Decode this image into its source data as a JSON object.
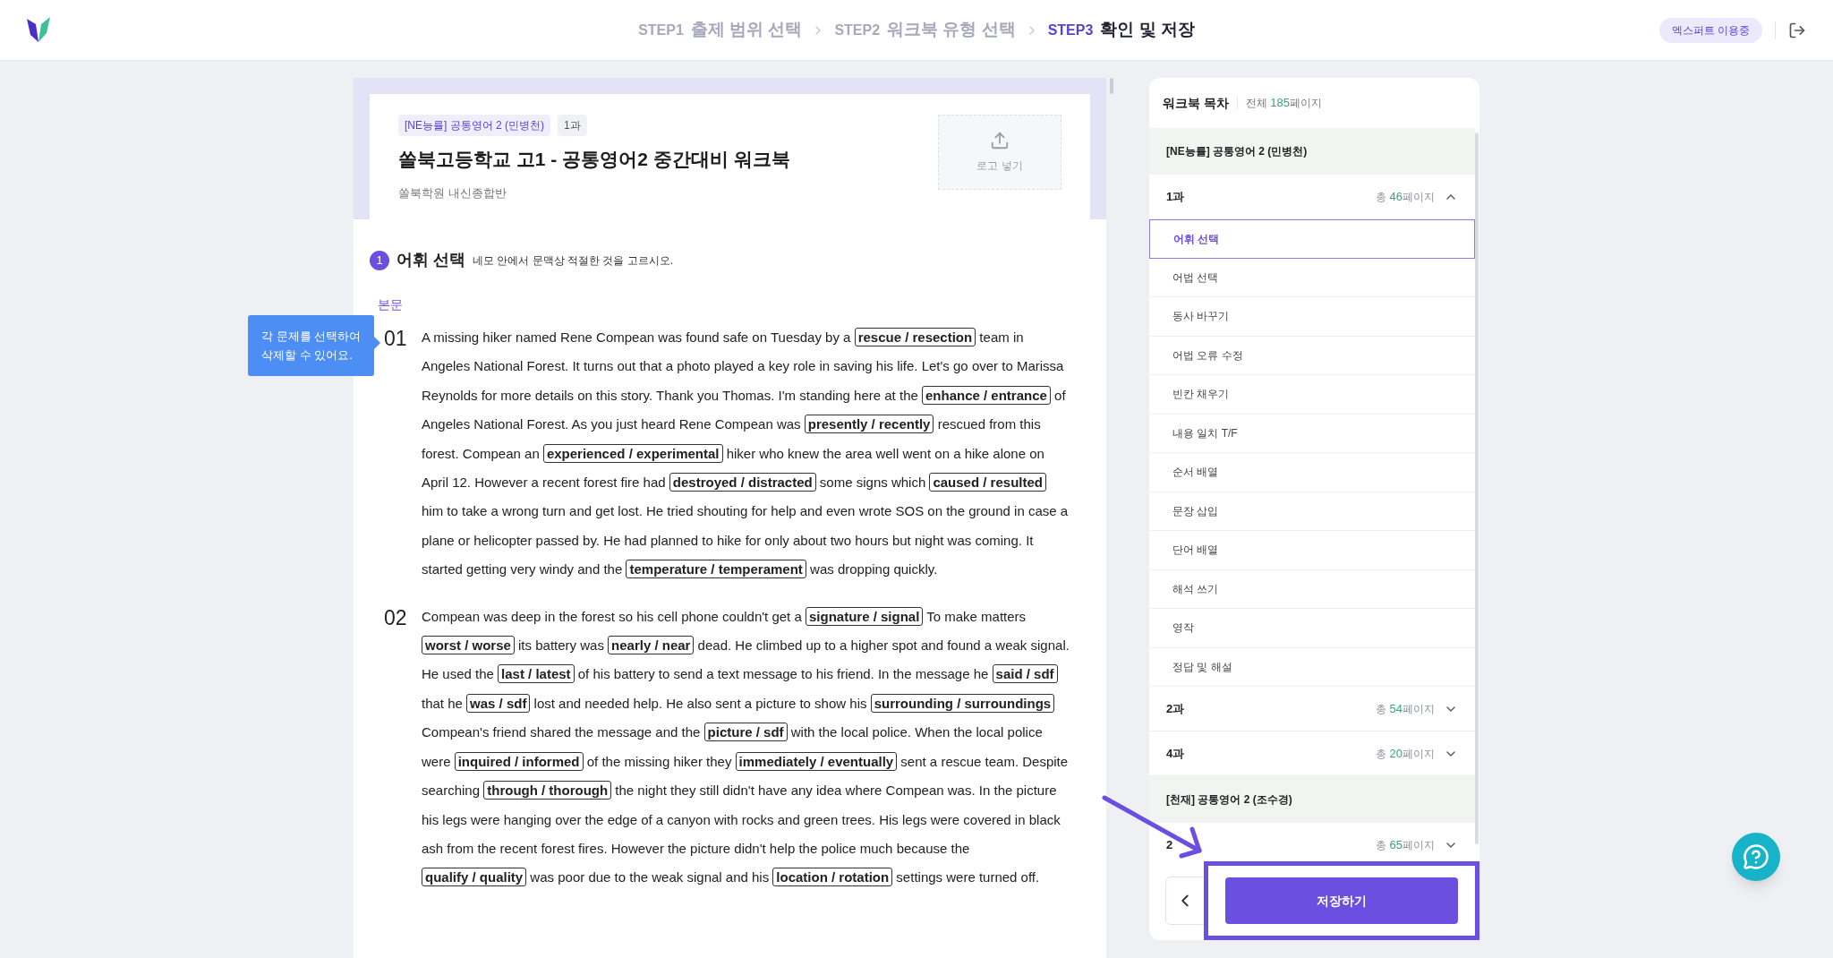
{
  "header": {
    "steps": [
      {
        "label": "STEP1",
        "title": "출제 범위 선택",
        "selected": false
      },
      {
        "label": "STEP2",
        "title": "워크북 유형 선택",
        "selected": false
      },
      {
        "label": "STEP3",
        "title": "확인 및 저장",
        "selected": true
      }
    ],
    "plan_badge": "엑스퍼트 이용중"
  },
  "document": {
    "tags": [
      "[NE능률] 공통영어 2 (민병천)",
      "1과"
    ],
    "title": "쏠북고등학교 고1 - 공통영어2 중간대비 워크북",
    "subtitle": "쏠북학원 내신종합반",
    "logo_upload": "로고 넣기",
    "tooltip": [
      "각 문제를 선택하여",
      "삭제할 수 있어요."
    ],
    "section": {
      "number": "1",
      "title": "어휘 선택",
      "instruction": "네모 안에서 문맥상 적절한 것을 고르시오.",
      "label": "본문",
      "questions": [
        {
          "number": "01",
          "segments": [
            {
              "kind": "text",
              "text": "A missing hiker named Rene Compean was found safe on Tuesday by a "
            },
            {
              "kind": "choice",
              "text": "rescue / resection"
            },
            {
              "kind": "text",
              "text": " team in Angeles National Forest. It turns out that a photo played a key role in saving his life. Let's go over to Marissa Reynolds for more details on this story. Thank you Thomas. I'm standing here at the "
            },
            {
              "kind": "choice",
              "text": "enhance / entrance"
            },
            {
              "kind": "text",
              "text": " of Angeles National Forest. As you just heard Rene Compean was "
            },
            {
              "kind": "choice",
              "text": "presently / recently"
            },
            {
              "kind": "text",
              "text": " rescued from this forest. Compean an "
            },
            {
              "kind": "choice",
              "text": "experienced / experimental"
            },
            {
              "kind": "text",
              "text": " hiker who knew the area well went on a hike alone on April 12. However a recent forest fire had "
            },
            {
              "kind": "choice",
              "text": "destroyed / distracted"
            },
            {
              "kind": "text",
              "text": " some signs which "
            },
            {
              "kind": "choice",
              "text": "caused / resulted"
            },
            {
              "kind": "text",
              "text": " him to take a wrong turn and get lost. He tried shouting for help and even wrote SOS on the ground in case a plane or helicopter passed by. He had planned to hike for only about two hours but night was coming. It started getting very windy and the "
            },
            {
              "kind": "choice",
              "text": "temperature / temperament"
            },
            {
              "kind": "text",
              "text": " was dropping quickly."
            }
          ]
        },
        {
          "number": "02",
          "segments": [
            {
              "kind": "text",
              "text": "Compean was deep in the forest so his cell phone couldn't get a "
            },
            {
              "kind": "choice",
              "text": "signature / signal"
            },
            {
              "kind": "text",
              "text": " To make matters "
            },
            {
              "kind": "choice",
              "text": "worst / worse"
            },
            {
              "kind": "text",
              "text": " its battery was "
            },
            {
              "kind": "choice",
              "text": "nearly / near"
            },
            {
              "kind": "text",
              "text": " dead. He climbed up to a higher spot and found a weak signal. He used the "
            },
            {
              "kind": "choice",
              "text": "last / latest"
            },
            {
              "kind": "text",
              "text": " of his battery to send a text message to his friend. In the message he "
            },
            {
              "kind": "choice",
              "text": "said / sdf"
            },
            {
              "kind": "text",
              "text": " that he "
            },
            {
              "kind": "choice",
              "text": "was / sdf"
            },
            {
              "kind": "text",
              "text": " lost and needed help. He also sent a picture to show his "
            },
            {
              "kind": "choice",
              "text": "surrounding / surroundings"
            },
            {
              "kind": "text",
              "text": "  Compean's friend shared the message and the "
            },
            {
              "kind": "choice",
              "text": "picture / sdf"
            },
            {
              "kind": "text",
              "text": " with the local police. When the local police were "
            },
            {
              "kind": "choice",
              "text": "inquired / informed"
            },
            {
              "kind": "text",
              "text": " of the missing hiker they "
            },
            {
              "kind": "choice",
              "text": "immediately / eventually"
            },
            {
              "kind": "text",
              "text": " sent a rescue team. Despite searching "
            },
            {
              "kind": "choice",
              "text": "through / thorough"
            },
            {
              "kind": "text",
              "text": " the night they still didn't have any idea where Compean was. In the picture his legs were hanging over the edge of a canyon with rocks and green trees. His legs were covered in black ash from the recent forest fires. However the picture didn't help the police much because the "
            },
            {
              "kind": "choice",
              "text": "qualify / quality"
            },
            {
              "kind": "text",
              "text": " was poor due to the weak signal and his "
            },
            {
              "kind": "choice",
              "text": "location / rotation"
            },
            {
              "kind": "text",
              "text": " settings were turned off."
            }
          ]
        }
      ]
    }
  },
  "toc": {
    "title": "워크북 목차",
    "total_prefix": "전체 ",
    "total_count": "185",
    "total_suffix": "페이지",
    "rows": [
      {
        "kind": "book",
        "title": "[NE능률] 공통영어 2 (민병천)"
      },
      {
        "kind": "unit",
        "title": "1과",
        "pages_prefix": "총 ",
        "pages_count": "46",
        "pages_suffix": "페이지",
        "expanded": true,
        "children": [
          {
            "label": "어휘 선택",
            "selected": true
          },
          {
            "label": "어법 선택",
            "selected": false
          },
          {
            "label": "동사 바꾸기",
            "selected": false
          },
          {
            "label": "어법 오류 수정",
            "selected": false
          },
          {
            "label": "빈칸 채우기",
            "selected": false
          },
          {
            "label": "내용 일치 T/F",
            "selected": false
          },
          {
            "label": "순서 배열",
            "selected": false
          },
          {
            "label": "문장 삽입",
            "selected": false
          },
          {
            "label": "단어 배열",
            "selected": false
          },
          {
            "label": "해석 쓰기",
            "selected": false
          },
          {
            "label": "영작",
            "selected": false
          },
          {
            "label": "정답 및 해설",
            "selected": false
          }
        ]
      },
      {
        "kind": "unit",
        "title": "2과",
        "pages_prefix": "총 ",
        "pages_count": "54",
        "pages_suffix": "페이지",
        "expanded": false
      },
      {
        "kind": "unit",
        "title": "4과",
        "pages_prefix": "총 ",
        "pages_count": "20",
        "pages_suffix": "페이지",
        "expanded": false
      },
      {
        "kind": "book",
        "title": "[천재] 공통영어 2 (조수경)"
      },
      {
        "kind": "unit",
        "title": "2",
        "pages_prefix": "총 ",
        "pages_count": "65",
        "pages_suffix": "페이지",
        "expanded": false
      }
    ]
  },
  "footer": {
    "save_button": "저장하기"
  }
}
